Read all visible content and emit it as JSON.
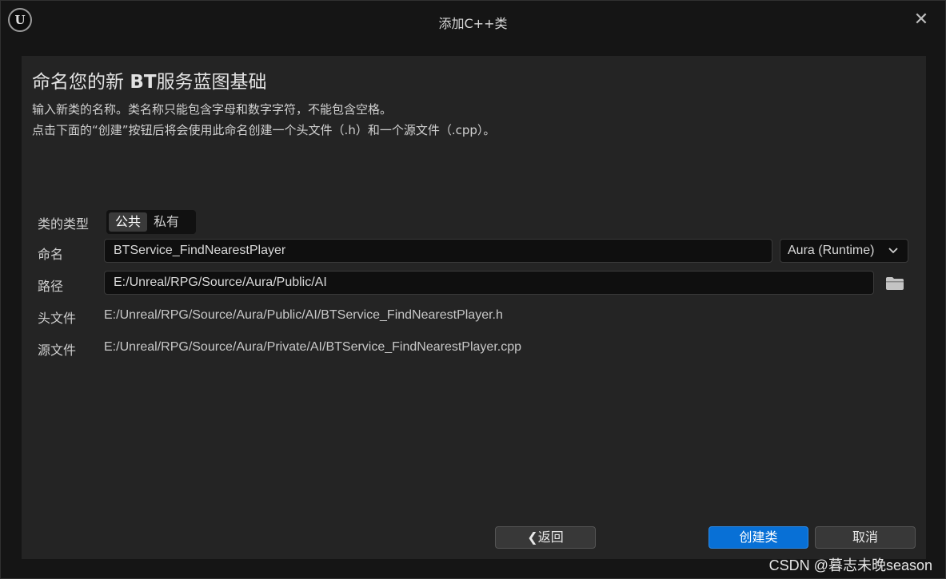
{
  "window": {
    "title": "添加C++类",
    "logo_text": "U",
    "close_glyph": "✕"
  },
  "heading": {
    "prefix": "命名您的新 ",
    "bold": "BT",
    "suffix": "服务蓝图基础"
  },
  "description": {
    "line1": "输入新类的名称。类名称只能包含字母和数字字符，不能包含空格。",
    "line2": "点击下面的“创建”按钮后将会使用此命名创建一个头文件（.h）和一个源文件（.cpp）。"
  },
  "class_type": {
    "label": "类的类型",
    "options": [
      "公共",
      "私有"
    ],
    "selected": "公共"
  },
  "name": {
    "label": "命名",
    "value": "BTService_FindNearestPlayer",
    "module": "Aura (Runtime)"
  },
  "path": {
    "label": "路径",
    "value": "E:/Unreal/RPG/Source/Aura/Public/AI"
  },
  "header_file": {
    "label": "头文件",
    "value": "E:/Unreal/RPG/Source/Aura/Public/AI/BTService_FindNearestPlayer.h"
  },
  "source_file": {
    "label": "源文件",
    "value": "E:/Unreal/RPG/Source/Aura/Private/AI/BTService_FindNearestPlayer.cpp"
  },
  "buttons": {
    "back": "❮返回",
    "create": "创建类",
    "cancel": "取消"
  },
  "watermark": "CSDN @暮志未晚season",
  "colors": {
    "accent": "#0870d6",
    "panel": "#242424",
    "background": "#151515"
  }
}
